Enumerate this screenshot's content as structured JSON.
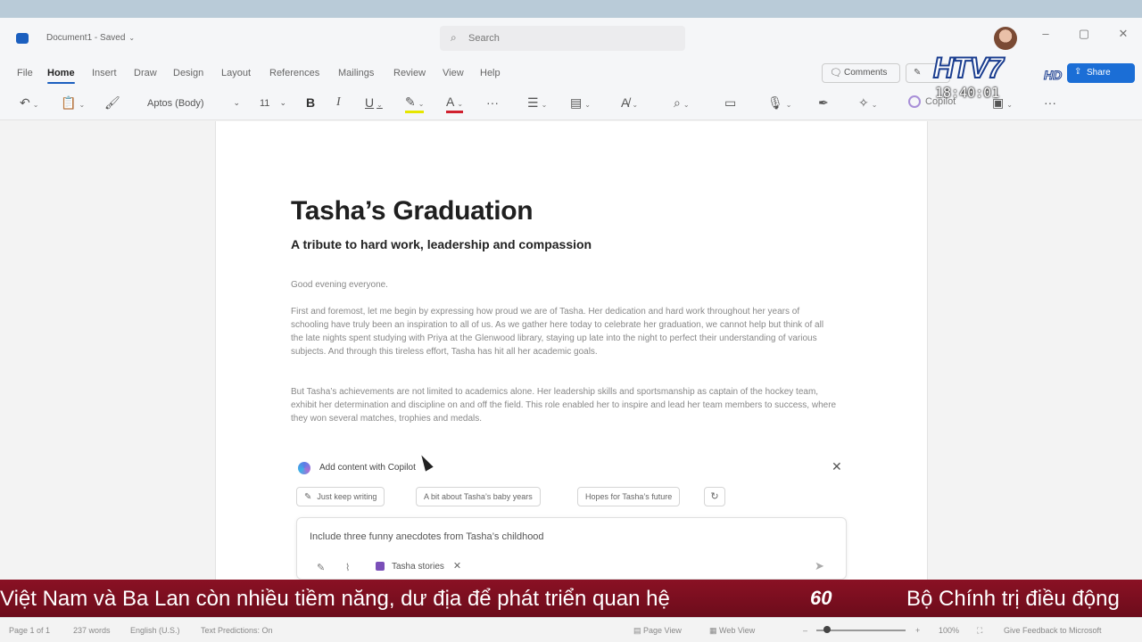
{
  "titlebar": {
    "doc_title": "Document1 - Saved",
    "search_placeholder": "Search"
  },
  "ribbon": {
    "tabs": [
      "File",
      "Home",
      "Insert",
      "Draw",
      "Design",
      "Layout",
      "References",
      "Mailings",
      "Review",
      "View",
      "Help"
    ],
    "active_tab": "Home",
    "comments_label": "Comments",
    "share_label": "Share",
    "font_name": "Aptos (Body)",
    "font_size": "11",
    "copilot_label": "Copilot"
  },
  "document": {
    "title": "Tasha’s Graduation",
    "subtitle": "A tribute to hard work, leadership and compassion",
    "greeting": "Good evening everyone.",
    "paragraph1": "First and foremost, let me begin by expressing how proud we are of Tasha. Her dedication and hard work throughout her years of schooling have truly been an inspiration to all of us. As we gather here today to celebrate her graduation, we cannot help but think of all the late nights spent studying with Priya at the Glenwood library, staying up late into the night to perfect their understanding of various subjects. And through this tireless effort, Tasha has hit all her academic goals.",
    "paragraph2": "But Tasha’s achievements are not limited to academics alone. Her leadership skills and sportsmanship as captain of the hockey team, exhibit her determination and discipline on and off the field. This role enabled her to inspire and lead her team members to success, where they won several matches, trophies and medals."
  },
  "copilot": {
    "panel_title": "Add content with Copilot",
    "chips": [
      "Just keep writing",
      "A bit about Tasha’s baby years",
      "Hopes for Tasha’s future"
    ],
    "prompt": "Include three funny anecdotes from Tasha’s childhood",
    "reference_file": "Tasha stories"
  },
  "overlay": {
    "channel": "HTV7",
    "channel_suffix": "HD",
    "clock": "18:40:01",
    "ticker_left": "Việt Nam và Ba Lan còn nhiều tiềm năng, dư địa để phát triển quan hệ",
    "ticker_logo": "60",
    "ticker_right": "Bộ Chính trị điều động"
  },
  "statusbar": {
    "page": "Page 1 of 1",
    "words": "237 words",
    "language": "English (U.S.)",
    "predictions": "Text Predictions: On",
    "page_view": "Page View",
    "web_view": "Web View",
    "zoom": "100%",
    "feedback": "Give Feedback to Microsoft"
  },
  "icons": {
    "undo": "undo-icon",
    "paste": "clipboard-icon",
    "format_painter": "brush-icon",
    "bold": "bold-icon",
    "italic": "italic-icon",
    "underline": "underline-icon",
    "highlight": "highlighter-icon",
    "font_color": "font-color-icon",
    "more": "more-icon",
    "bullets": "bullets-icon",
    "align": "align-icon",
    "styles": "styles-icon",
    "find": "search-icon",
    "dictate": "microphone-icon",
    "editor": "pen-icon"
  },
  "colors": {
    "accent": "#1b6ed6",
    "ticker_bg": "#7a0f1f",
    "highlight": "#e6e600",
    "font_color": "#d0202e"
  }
}
